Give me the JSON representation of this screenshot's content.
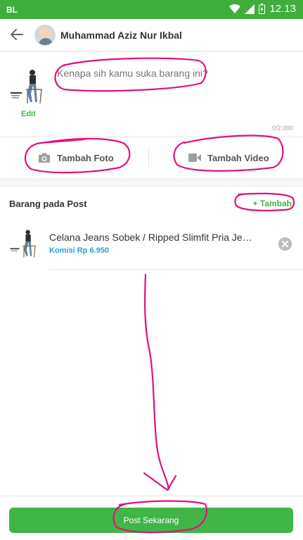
{
  "status_bar": {
    "carrier": "BL",
    "time": "12.13"
  },
  "header": {
    "title": "Muhammad Aziz Nur Ikbal"
  },
  "post": {
    "edit_label": "Edit",
    "caption_placeholder": "Kenapa sih kamu suka barang ini?",
    "caption_value": "",
    "char_counter": "0/2.000"
  },
  "media": {
    "photo_label": "Tambah Foto",
    "video_label": "Tambah Video"
  },
  "products": {
    "title": "Barang pada Post",
    "add_label": "+ Tambah",
    "items": [
      {
        "name": "Celana Jeans Sobek / Ripped Slimfit Pria Jeans...",
        "commission": "Komisi Rp 6.950"
      }
    ]
  },
  "footer": {
    "post_label": "Post Sekarang"
  },
  "colors": {
    "brand_green": "#42b549",
    "status_green": "#3fae3c",
    "commission_blue": "#1aa5d6",
    "annotation_magenta": "#e0117f"
  }
}
